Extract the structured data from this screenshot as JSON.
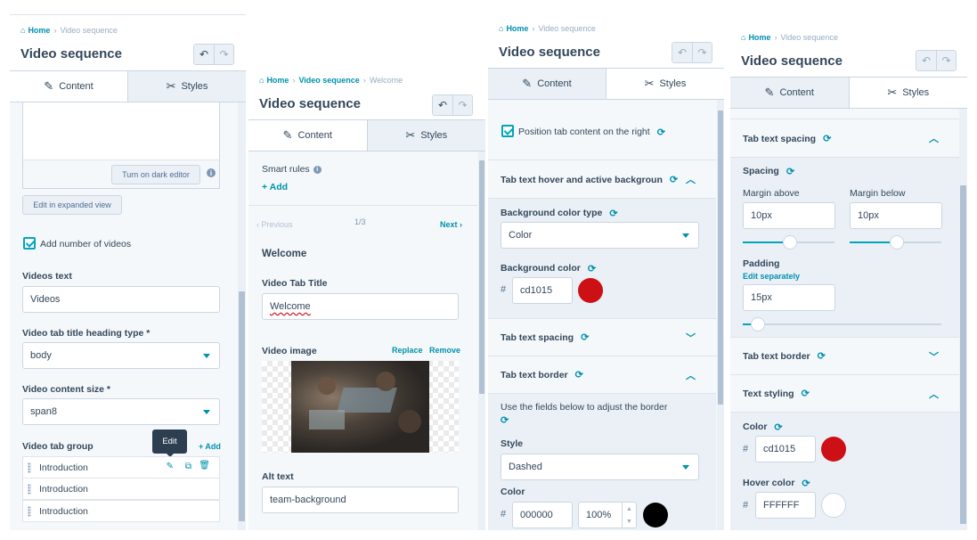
{
  "crumbs": {
    "home": "Home",
    "video_sequence": "Video sequence",
    "welcome": "Welcome"
  },
  "title": "Video sequence",
  "tabs": {
    "content": "Content",
    "styles": "Styles"
  },
  "panel1": {
    "dark_editor_btn": "Turn on dark editor",
    "expanded_view_btn": "Edit in expanded view",
    "add_number_label": "Add number of videos",
    "videos_text_label": "Videos text",
    "videos_text_value": "Videos",
    "heading_type_label": "Video tab title heading type *",
    "heading_type_value": "body",
    "content_size_label": "Video content size *",
    "content_size_value": "span8",
    "tab_group_label": "Video tab group",
    "tooltip": "Edit",
    "add_link": "+ Add",
    "items": [
      "Introduction",
      "Introduction",
      "Introduction"
    ]
  },
  "panel2": {
    "smart_rules_label": "Smart rules",
    "add_link": "+ Add",
    "previous": "‹ Previous",
    "pager": "1/3",
    "next": "Next ›",
    "section_title": "Welcome",
    "tab_title_label": "Video Tab Title",
    "tab_title_value": "Welcome",
    "image_label": "Video image",
    "replace": "Replace",
    "remove": "Remove",
    "alt_label": "Alt text",
    "alt_value": "team-background"
  },
  "panel3": {
    "position_right_label": "Position tab content on the right",
    "hover_section": "Tab text hover and active backgroun",
    "bg_type_label": "Background color type",
    "bg_type_value": "Color",
    "bg_color_label": "Background color",
    "bg_color_value": "cd1015",
    "spacing_section": "Tab text spacing",
    "border_section": "Tab text border",
    "border_help": "Use the fields below to adjust the border",
    "style_label": "Style",
    "style_value": "Dashed",
    "color_label": "Color",
    "color_value": "000000",
    "opacity_value": "100%",
    "hash": "#"
  },
  "panel4": {
    "spacing_section": "Tab text spacing",
    "spacing_label": "Spacing",
    "margin_above_label": "Margin above",
    "margin_above_value": "10px",
    "margin_below_label": "Margin below",
    "margin_below_value": "10px",
    "padding_label": "Padding",
    "edit_separately": "Edit separately",
    "padding_value": "15px",
    "border_section": "Tab text border",
    "styling_section": "Text styling",
    "color_label": "Color",
    "color_value": "cd1015",
    "hover_label": "Hover color",
    "hover_value": "FFFFFF",
    "hash": "#"
  },
  "colors": {
    "accent": "#0091ae",
    "swatch_red": "#cd1015",
    "swatch_black": "#000000",
    "swatch_white": "#ffffff"
  }
}
